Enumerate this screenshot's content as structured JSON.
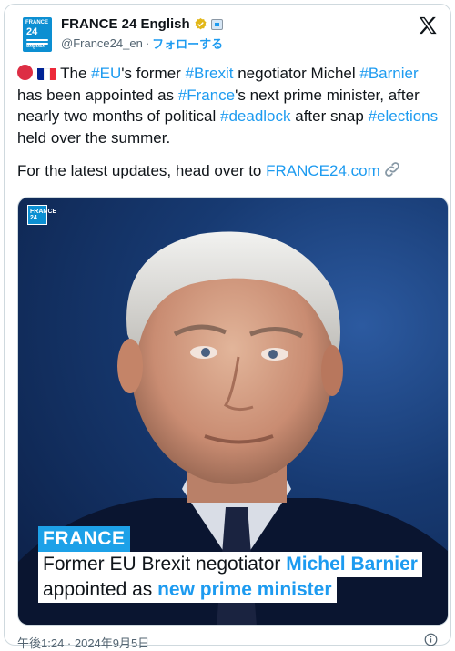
{
  "account": {
    "display_name": "FRANCE 24 English",
    "handle": "@France24_en",
    "separator": "·",
    "follow_label": "フォローする",
    "avatar_text": {
      "line1": "FRANCE",
      "line2": "24",
      "line3": "english"
    }
  },
  "tweet": {
    "segments": [
      {
        "text": " The "
      },
      {
        "text": "#EU",
        "type": "hashtag"
      },
      {
        "text": "'s former "
      },
      {
        "text": "#Brexit",
        "type": "hashtag"
      },
      {
        "text": " negotiator Michel "
      },
      {
        "text": "#Barnier",
        "type": "hashtag"
      },
      {
        "text": " has been appointed as "
      },
      {
        "text": "#France",
        "type": "hashtag"
      },
      {
        "text": "'s next prime minister, after nearly two months of political "
      },
      {
        "text": "#deadlock",
        "type": "hashtag"
      },
      {
        "text": " after snap "
      },
      {
        "text": "#elections",
        "type": "hashtag"
      },
      {
        "text": " held over the summer."
      }
    ],
    "updates_prefix": "For the latest updates, head over to ",
    "updates_link": "FRANCE24.com"
  },
  "media": {
    "logo_text": "FRANCE 24",
    "tag": "FRANCE",
    "line1_plain": "Former EU Brexit negotiator ",
    "line1_bold": "Michel Barnier",
    "line2_plain": "appointed as ",
    "line2_bold": "new prime minister"
  },
  "timestamp": "午後1:24 · 2024年9月5日",
  "colors": {
    "link": "#1d9bf0",
    "brand": "#0c8fd2",
    "tag_bg": "#1da1e8"
  },
  "icons": [
    "verified-badge-icon",
    "affiliation-badge-icon",
    "x-logo-icon",
    "link-icon",
    "info-icon",
    "red-circle-emoji",
    "france-flag-emoji"
  ]
}
